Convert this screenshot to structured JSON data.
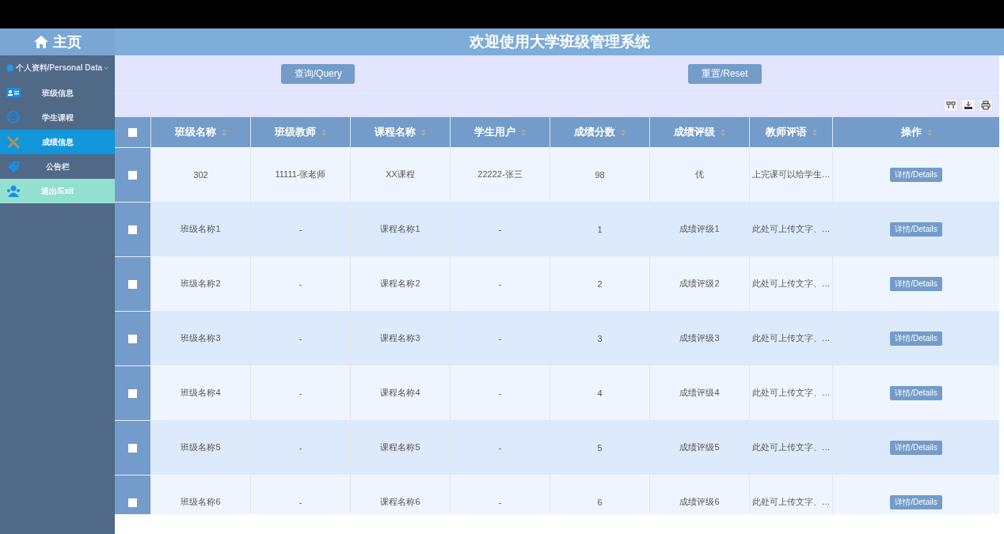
{
  "sidebar": {
    "home": "主页",
    "section": {
      "label": "个人资料/Personal Data",
      "expanded": true
    },
    "items": [
      {
        "label": "班级信息",
        "selected": false,
        "kind": "normal"
      },
      {
        "label": "学生课程",
        "selected": false,
        "kind": "normal"
      },
      {
        "label": "成绩信息",
        "selected": true,
        "kind": "normal"
      },
      {
        "label": "公告栏",
        "selected": false,
        "kind": "normal"
      },
      {
        "label": "退出/Exit",
        "selected": false,
        "kind": "exit"
      }
    ]
  },
  "header": {
    "title": "欢迎使用大学班级管理系统"
  },
  "search_bar": {
    "buttons": [
      "查询/Query",
      "重置/Reset"
    ]
  },
  "table": {
    "select_all": {
      "checked": false
    },
    "columns": [
      "班级名称",
      "班级教师",
      "课程名称",
      "学生用户",
      "成绩分数",
      "成绩评级",
      "教师评语",
      "操作"
    ],
    "rows": [
      {
        "checked": false,
        "cells": [
          "302",
          "11111-张老师",
          "XX课程",
          "22222-张三",
          "98",
          "优",
          "上完课可以给学生…"
        ],
        "action": "详情/Details"
      },
      {
        "checked": false,
        "cells": [
          "班级名称1",
          "-",
          "课程名称1",
          "-",
          "1",
          "成绩评级1",
          "此处可上传文字、…"
        ],
        "action": "详情/Details"
      },
      {
        "checked": false,
        "cells": [
          "班级名称2",
          "-",
          "课程名称2",
          "-",
          "2",
          "成绩评级2",
          "此处可上传文字、…"
        ],
        "action": "详情/Details"
      },
      {
        "checked": false,
        "cells": [
          "班级名称3",
          "-",
          "课程名称3",
          "-",
          "3",
          "成绩评级3",
          "此处可上传文字、…"
        ],
        "action": "详情/Details"
      },
      {
        "checked": false,
        "cells": [
          "班级名称4",
          "-",
          "课程名称4",
          "-",
          "4",
          "成绩评级4",
          "此处可上传文字、…"
        ],
        "action": "详情/Details"
      },
      {
        "checked": false,
        "cells": [
          "班级名称5",
          "-",
          "课程名称5",
          "-",
          "5",
          "成绩评级5",
          "此处可上传文字、…"
        ],
        "action": "详情/Details"
      },
      {
        "checked": false,
        "cells": [
          "班级名称6",
          "-",
          "课程名称6",
          "-",
          "6",
          "成绩评级6",
          "此处可上传文字、…"
        ],
        "action": "详情/Details"
      }
    ]
  }
}
